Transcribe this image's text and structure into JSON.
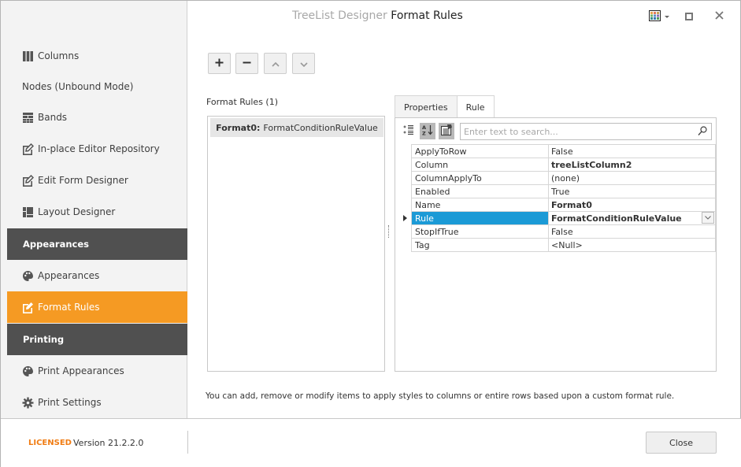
{
  "window": {
    "title_prefix": "TreeList Designer",
    "title_main": "Format Rules"
  },
  "sidebar": {
    "items": [
      {
        "label": "Columns",
        "icon": "columns-icon"
      },
      {
        "label": "Nodes (Unbound Mode)",
        "icon": ""
      },
      {
        "label": "Bands",
        "icon": "bands-icon"
      },
      {
        "label": "In-place Editor Repository",
        "icon": "edit-icon"
      },
      {
        "label": "Edit Form Designer",
        "icon": "edit-icon"
      },
      {
        "label": "Layout Designer",
        "icon": "layout-icon"
      }
    ],
    "group_appearances": "Appearances",
    "appearances_items": [
      {
        "label": "Appearances",
        "icon": "palette-icon"
      },
      {
        "label": "Format Rules",
        "icon": "edit-icon",
        "active": true
      }
    ],
    "group_printing": "Printing",
    "printing_items": [
      {
        "label": "Print Appearances",
        "icon": "palette-icon"
      },
      {
        "label": "Print Settings",
        "icon": "gear-icon"
      }
    ]
  },
  "toolbar": {
    "add": "+",
    "remove": "−",
    "move_up": "up",
    "move_down": "down"
  },
  "rules": {
    "label": "Format Rules (1)",
    "items": [
      {
        "name": "Format0:",
        "type": "FormatConditionRuleValue"
      }
    ]
  },
  "tabs": [
    {
      "label": "Properties",
      "active": true
    },
    {
      "label": "Rule",
      "active": false
    }
  ],
  "search": {
    "placeholder": "Enter text to search...",
    "value": ""
  },
  "properties": [
    {
      "name": "ApplyToRow",
      "value": "False",
      "bold": false
    },
    {
      "name": "Column",
      "value": "treeListColumn2",
      "bold": true
    },
    {
      "name": "ColumnApplyTo",
      "value": "(none)",
      "bold": false
    },
    {
      "name": "Enabled",
      "value": "True",
      "bold": false
    },
    {
      "name": "Name",
      "value": "Format0",
      "bold": true
    },
    {
      "name": "Rule",
      "value": "FormatConditionRuleValue",
      "bold": true,
      "selected": true
    },
    {
      "name": "StopIfTrue",
      "value": "False",
      "bold": false
    },
    {
      "name": "Tag",
      "value": "<Null>",
      "bold": false
    }
  ],
  "hint": "You can add, remove or modify items to apply styles to columns or entire rows based upon a custom format rule.",
  "footer": {
    "licensed": "LICENSED",
    "version": "Version 21.2.2.0",
    "close": "Close"
  },
  "colors": {
    "accent": "#f59a23",
    "group_header": "#505050",
    "selection": "#1b9ad6",
    "licensed": "#f07c13"
  }
}
